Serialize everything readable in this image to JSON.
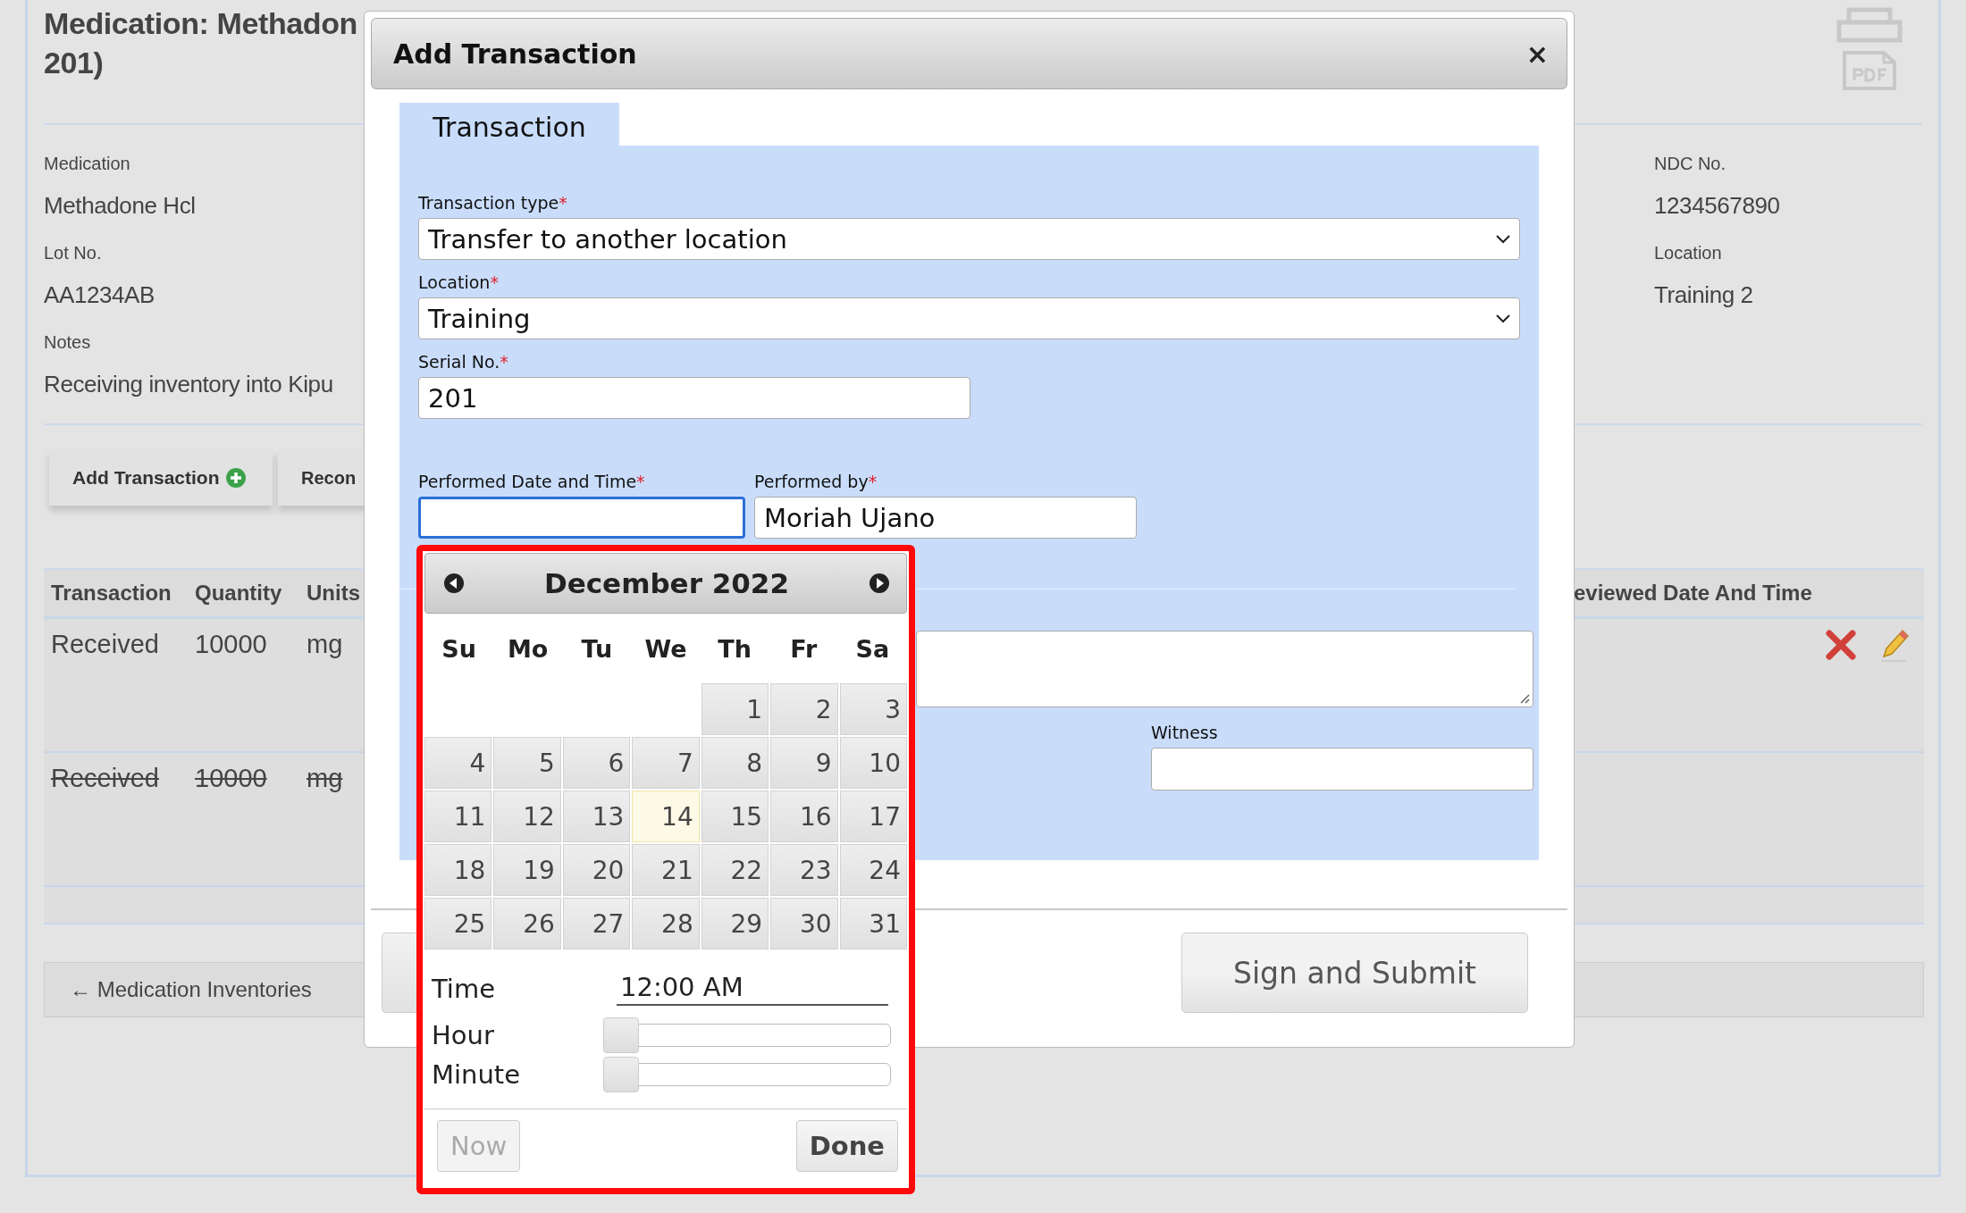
{
  "page": {
    "title_lines": [
      "Medication: Methadon",
      "201)"
    ],
    "details_left": [
      {
        "label": "Medication",
        "value": "Methadone Hcl"
      },
      {
        "label": "Lot No.",
        "value": "AA1234AB"
      },
      {
        "label": "Notes",
        "value": "Receiving inventory into Kipu"
      }
    ],
    "details_right": [
      {
        "label": "NDC No.",
        "value": "1234567890"
      },
      {
        "label": "Location",
        "value": "Training 2"
      }
    ],
    "actions": [
      {
        "label": "Add Transaction",
        "kind": "add"
      },
      {
        "label": "Recon",
        "kind": "plain"
      }
    ],
    "table": {
      "columns": [
        "Transaction",
        "Quantity",
        "Units",
        "eviewed Date And Time"
      ],
      "rows": [
        {
          "cells": [
            "Received",
            "10000",
            "mg"
          ],
          "voided": false,
          "actions": true
        },
        {
          "cells": [
            "Received",
            "10000",
            "mg"
          ],
          "voided": true,
          "actions": false
        }
      ]
    },
    "back_link": "← Medication Inventories"
  },
  "dialog": {
    "title": "Add Transaction",
    "close": "×",
    "tabs": [
      {
        "label": "Transaction",
        "selected": true
      }
    ],
    "rows": [
      [
        {
          "label": "Transaction type",
          "required_mark": "*",
          "kind": "select",
          "value": "Transfer to another location",
          "focused": false
        }
      ],
      [
        {
          "label": "Location",
          "required_mark": "*",
          "kind": "select",
          "value": "Training",
          "focused": false
        }
      ],
      [
        {
          "label": "Serial No.",
          "required_mark": "*",
          "kind": "text",
          "value": "201",
          "focused": false
        }
      ],
      [
        {
          "label": "Performed Date and Time",
          "required_mark": "*",
          "kind": "text",
          "focused": true
        },
        {
          "label": "Performed by",
          "required_mark": "*",
          "kind": "text",
          "value": "Moriah Ujano",
          "focused": false
        }
      ]
    ],
    "witness": {
      "label": "Witness"
    },
    "submit": "Sign and Submit"
  },
  "datepicker": {
    "month": "December 2022",
    "weekdays": [
      "Su",
      "Mo",
      "Tu",
      "We",
      "Th",
      "Fr",
      "Sa"
    ],
    "weeks": [
      [
        {
          "kind": "empty"
        },
        {
          "kind": "empty"
        },
        {
          "kind": "empty"
        },
        {
          "kind": "empty"
        },
        {
          "label": "1",
          "today": false
        },
        {
          "label": "2",
          "today": false
        },
        {
          "label": "3",
          "today": false
        }
      ],
      [
        {
          "label": "4",
          "today": false
        },
        {
          "label": "5",
          "today": false
        },
        {
          "label": "6",
          "today": false
        },
        {
          "label": "7",
          "today": false
        },
        {
          "label": "8",
          "today": false
        },
        {
          "label": "9",
          "today": false
        },
        {
          "label": "10",
          "today": false
        }
      ],
      [
        {
          "label": "11",
          "today": false
        },
        {
          "label": "12",
          "today": false
        },
        {
          "label": "13",
          "today": false
        },
        {
          "label": "14",
          "today": true
        },
        {
          "label": "15",
          "today": false
        },
        {
          "label": "16",
          "today": false
        },
        {
          "label": "17",
          "today": false
        }
      ],
      [
        {
          "label": "18",
          "today": false
        },
        {
          "label": "19",
          "today": false
        },
        {
          "label": "20",
          "today": false
        },
        {
          "label": "21",
          "today": false
        },
        {
          "label": "22",
          "today": false
        },
        {
          "label": "23",
          "today": false
        },
        {
          "label": "24",
          "today": false
        }
      ],
      [
        {
          "label": "25",
          "today": false
        },
        {
          "label": "26",
          "today": false
        },
        {
          "label": "27",
          "today": false
        },
        {
          "label": "28",
          "today": false
        },
        {
          "label": "29",
          "today": false
        },
        {
          "label": "30",
          "today": false
        },
        {
          "label": "31",
          "today": false
        }
      ]
    ],
    "time": {
      "label": "Time",
      "value": "12:00 AM"
    },
    "sliders": [
      {
        "label": "Hour",
        "level": 0
      },
      {
        "label": "Minute",
        "level": 0
      }
    ],
    "buttons": [
      {
        "label": "Now",
        "disabled": true
      },
      {
        "label": "Done",
        "disabled": false
      }
    ]
  }
}
